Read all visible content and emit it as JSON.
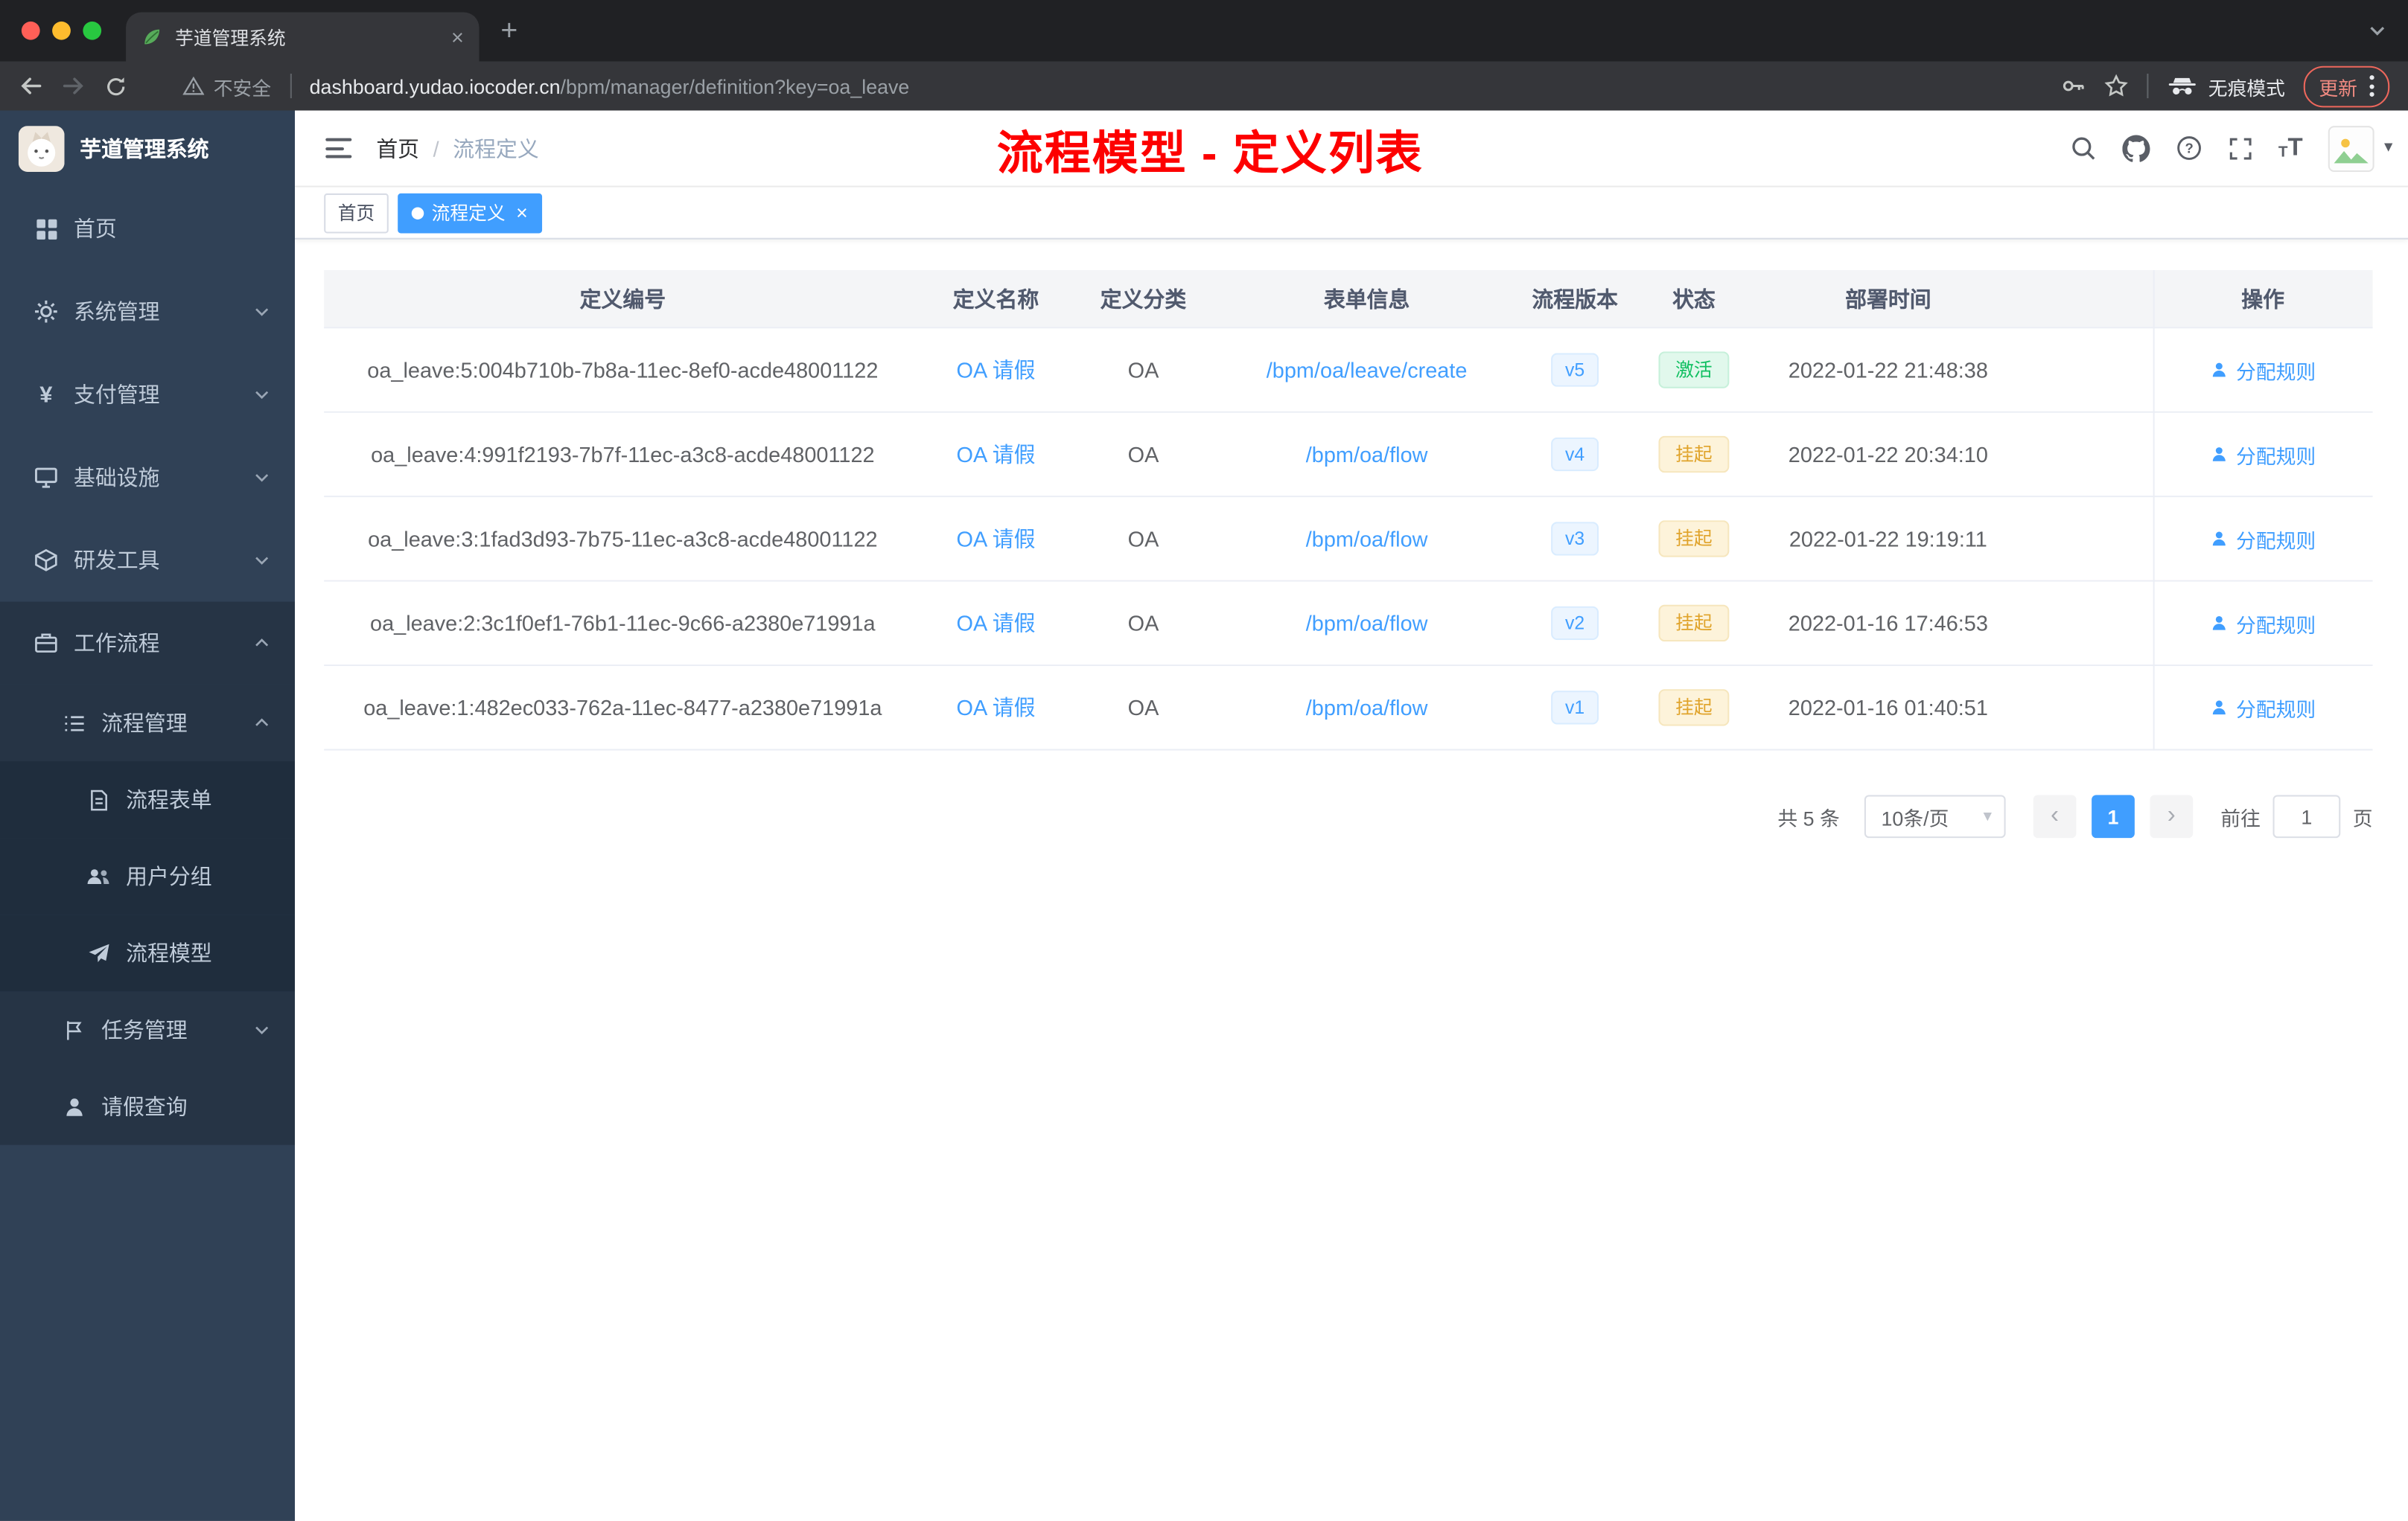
{
  "browser": {
    "tab": {
      "title": "芋道管理系统"
    },
    "address": {
      "security": "不安全",
      "host": "dashboard.yudao.iocoder.cn",
      "path": "/bpm/manager/definition?key=oa_leave"
    },
    "profile": {
      "incognito": "无痕模式",
      "update": "更新"
    }
  },
  "icons": {
    "close": "×",
    "plus": "+",
    "yen": "¥",
    "caret_down": "▾",
    "prev": "‹",
    "next": "›",
    "font_large": "T",
    "font_small": "T"
  },
  "app": {
    "sidebar": {
      "title": "芋道管理系统",
      "menu": [
        {
          "label": "首页"
        },
        {
          "label": "系统管理"
        },
        {
          "label": "支付管理"
        },
        {
          "label": "基础设施"
        },
        {
          "label": "研发工具"
        },
        {
          "label": "工作流程"
        },
        {
          "label": "流程管理"
        },
        {
          "label": "流程表单"
        },
        {
          "label": "用户分组"
        },
        {
          "label": "流程模型"
        },
        {
          "label": "任务管理"
        },
        {
          "label": "请假查询"
        }
      ]
    },
    "header": {
      "breadcrumb": {
        "home": "首页",
        "sep": "/",
        "current": "流程定义"
      },
      "annotation": "流程模型 - 定义列表"
    },
    "tags": {
      "items": [
        {
          "label": "首页"
        },
        {
          "label": "流程定义"
        }
      ]
    },
    "table": {
      "columns": [
        "定义编号",
        "定义名称",
        "定义分类",
        "表单信息",
        "流程版本",
        "状态",
        "部署时间",
        "操作"
      ],
      "rows": [
        {
          "id": "oa_leave:5:004b710b-7b8a-11ec-8ef0-acde48001122",
          "name": "OA 请假",
          "category": "OA",
          "form": "/bpm/oa/leave/create",
          "version": "v5",
          "status": "激活",
          "deploy_time": "2022-01-22 21:48:38",
          "action": "分配规则"
        },
        {
          "id": "oa_leave:4:991f2193-7b7f-11ec-a3c8-acde48001122",
          "name": "OA 请假",
          "category": "OA",
          "form": "/bpm/oa/flow",
          "version": "v4",
          "status": "挂起",
          "deploy_time": "2022-01-22 20:34:10",
          "action": "分配规则"
        },
        {
          "id": "oa_leave:3:1fad3d93-7b75-11ec-a3c8-acde48001122",
          "name": "OA 请假",
          "category": "OA",
          "form": "/bpm/oa/flow",
          "version": "v3",
          "status": "挂起",
          "deploy_time": "2022-01-22 19:19:11",
          "action": "分配规则"
        },
        {
          "id": "oa_leave:2:3c1f0ef1-76b1-11ec-9c66-a2380e71991a",
          "name": "OA 请假",
          "category": "OA",
          "form": "/bpm/oa/flow",
          "version": "v2",
          "status": "挂起",
          "deploy_time": "2022-01-16 17:46:53",
          "action": "分配规则"
        },
        {
          "id": "oa_leave:1:482ec033-762a-11ec-8477-a2380e71991a",
          "name": "OA 请假",
          "category": "OA",
          "form": "/bpm/oa/flow",
          "version": "v1",
          "status": "挂起",
          "deploy_time": "2022-01-16 01:40:51",
          "action": "分配规则"
        }
      ]
    },
    "pagination": {
      "total": "共 5 条",
      "page_size": "10条/页",
      "page": "1",
      "goto_label": "前往",
      "goto_value": "1",
      "unit": "页"
    }
  },
  "colors": {
    "accent": "#409eff",
    "annotation_red": "#fd0000",
    "success": "#0fbf60",
    "warning": "#e0a32a",
    "sidebar_bg": "#304156"
  }
}
